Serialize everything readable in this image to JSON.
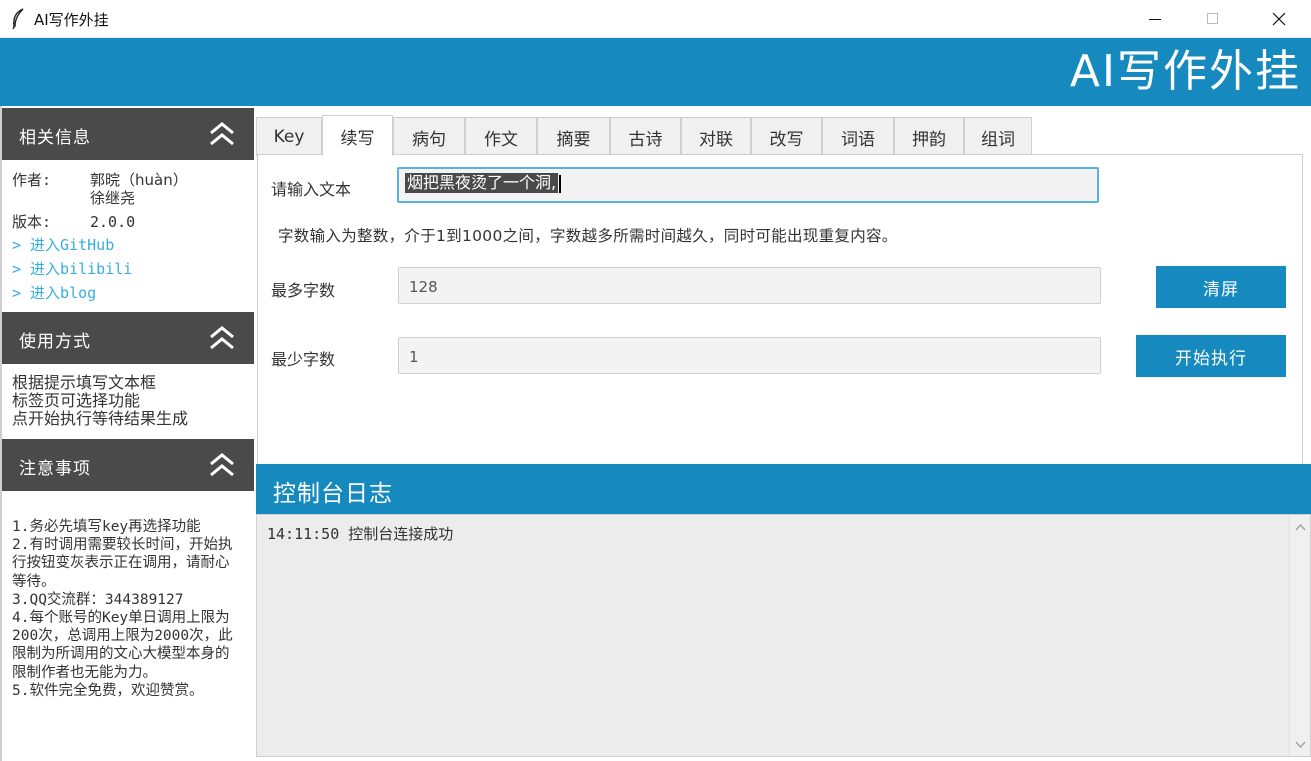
{
  "window": {
    "title": "AI写作外挂",
    "icon": "feather-icon",
    "controls": [
      "minimize-icon",
      "maximize-icon",
      "close-icon"
    ]
  },
  "banner": {
    "title": "AI写作外挂"
  },
  "colors": {
    "accent": "#168abf",
    "section_header": "#4a4a4a",
    "link": "#35aee0",
    "console_bg": "#ececec"
  },
  "sidebar": {
    "info": {
      "title": "相关信息",
      "author_label": "作者:",
      "author_1": "郭晥（huàn）",
      "author_2": "徐继尧",
      "version_label": "版本:",
      "version": "2.0.0",
      "links": [
        "> 进入GitHub",
        "> 进入bilibili",
        "> 进入blog"
      ]
    },
    "usage": {
      "title": "使用方式",
      "lines": [
        "根据提示填写文本框",
        "标签页可选择功能",
        "点开始执行等待结果生成"
      ]
    },
    "notes": {
      "title": "注意事项",
      "items": [
        "1.务必先填写key再选择功能",
        "2.有时调用需要较长时间，开始执行按钮变灰表示正在调用，请耐心等待。",
        "3.QQ交流群：344389127",
        "4.每个账号的Key单日调用上限为200次，总调用上限为2000次，此限制为所调用的文心大模型本身的限制作者也无能为力。",
        "5.软件完全免费，欢迎赞赏。"
      ]
    }
  },
  "tabs": {
    "items": [
      "Key",
      "续写",
      "病句",
      "作文",
      "摘要",
      "古诗",
      "对联",
      "改写",
      "词语",
      "押韵",
      "组词"
    ],
    "active": "续写"
  },
  "form": {
    "text_label": "请输入文本",
    "text_value": "烟把黑夜烫了一个洞,",
    "hint": "字数输入为整数，介于1到1000之间，字数越多所需时间越久，同时可能出现重复内容。",
    "max_label": "最多字数",
    "max_value": "128",
    "min_label": "最少字数",
    "min_value": "1",
    "clear_button": "清屏",
    "run_button": "开始执行"
  },
  "console": {
    "title": "控制台日志",
    "lines": [
      "14:11:50 控制台连接成功"
    ]
  }
}
